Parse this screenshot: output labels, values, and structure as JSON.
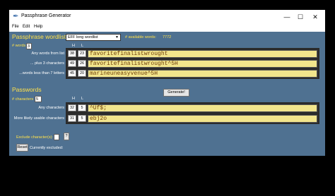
{
  "window": {
    "title": "Passphrase Generator",
    "minimize": "—",
    "maximize": "☐",
    "close": "✕"
  },
  "menu": [
    "File",
    "Edit",
    "Help"
  ],
  "wordlists": {
    "title": "Passphrase wordlists",
    "selected_list": "EFF long wordlist",
    "available_label": "# available words:",
    "available_count": "7772",
    "words_label": "# words",
    "words_value": "3"
  },
  "columns": {
    "h": "H",
    "l": "L"
  },
  "phrase_rows": [
    {
      "label": "Any words from list",
      "h": "38",
      "l": "23",
      "value": "favoritefinalistwrought"
    },
    {
      "label": "... plus 3 characters",
      "h": "49",
      "l": "26",
      "value": "favoritefinalistwrought^5H"
    },
    {
      "label": "...words less than 7 letters",
      "h": "45",
      "l": "20",
      "value": "marineuneasyvenue^5H"
    }
  ],
  "generate_label": "Generate!",
  "passwords": {
    "title": "Passwords",
    "chars_label": "# characters",
    "chars_value": "5",
    "rows": [
      {
        "label": "Any characters",
        "h": "32",
        "l": "5",
        "value": "^Uf$;"
      },
      {
        "label": "More likely usable characters",
        "h": "31",
        "l": "5",
        "value": "ebj2o"
      }
    ]
  },
  "exclude": {
    "label": "Exclude character(s):",
    "help": "?",
    "reset": "Reset",
    "currently": "Currently excluded:"
  }
}
